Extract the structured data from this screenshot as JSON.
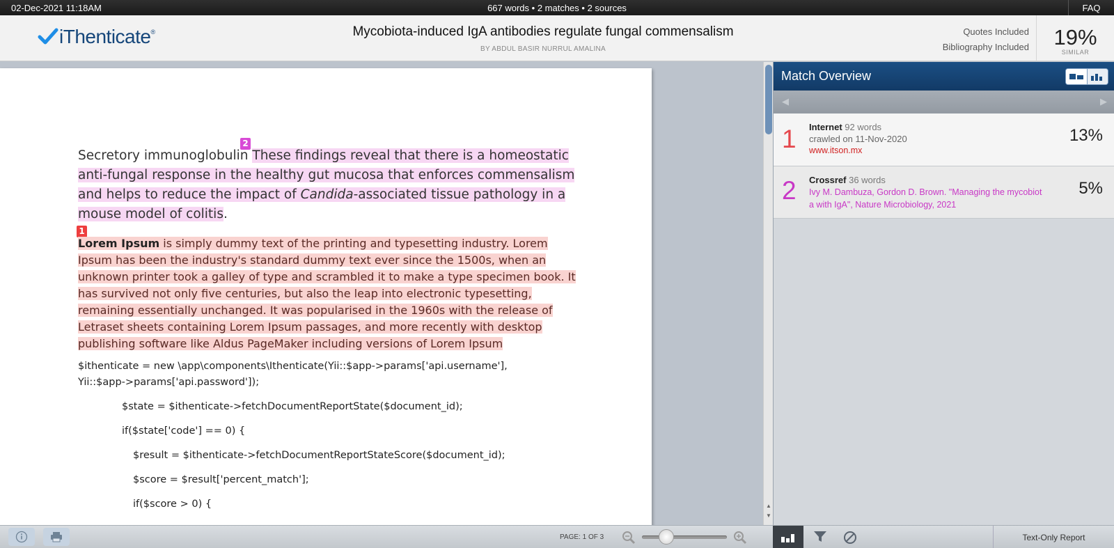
{
  "topbar": {
    "datetime": "02-Dec-2021 11:18AM",
    "summary": "667 words • 2 matches • 2 sources",
    "faq": "FAQ"
  },
  "header": {
    "logo_text": "iThenticate",
    "logo_reg": "®",
    "title": "Mycobiota-induced IgA antibodies regulate fungal commensalism",
    "author": "BY ABDUL BASIR NURRUL AMALINA",
    "quotes": "Quotes Included",
    "bibliography": "Bibliography Included",
    "similarity_pct": "19%",
    "similarity_label": "SIMILAR"
  },
  "document": {
    "para2_plain": "Secretory immunoglobulin ",
    "para2_marker": "2",
    "para2_hl_a": "These findings reveal that there is a homeostatic anti-fungal response in the healthy gut mucosa that enforces commensalism and helps to reduce the impact of ",
    "para2_hl_italic": "Candida",
    "para2_hl_b": "-associated tissue pathology in a mouse model of colitis",
    "para2_end": ".",
    "para1_marker": "1",
    "para1_bold": "Lorem Ipsum",
    "para1_rest": " is simply dummy text of the printing and typesetting industry. Lorem Ipsum has been the industry's standard dummy text ever since the 1500s, when an unknown printer took a galley of type and scrambled it to make a type specimen book. It has survived not only five centuries, but also the leap into electronic typesetting, remaining essentially unchanged. It was popularised in the 1960s with the release of Letraset sheets containing Lorem Ipsum passages, and more recently with desktop publishing software like Aldus PageMaker including versions of Lorem Ipsum",
    "code_lines": [
      "$ithenticate = new \\app\\components\\Ithenticate(Yii::$app->params['api.username'],",
      "Yii::$app->params['api.password']);",
      "$state = $ithenticate->fetchDocumentReportState($document_id);",
      "if($state['code'] == 0) {",
      "$result = $ithenticate->fetchDocumentReportStateScore($document_id);",
      "$score = $result['percent_match'];",
      "if($score > 0) {"
    ]
  },
  "panel": {
    "title": "Match Overview",
    "matches": [
      {
        "number": "1",
        "source": "Internet",
        "words": "92 words",
        "detail": "crawled on 11-Nov-2020",
        "link": "www.itson.mx",
        "percent": "13%",
        "color": "#e5484d"
      },
      {
        "number": "2",
        "source": "Crossref",
        "words": "36 words",
        "link_line1": "Ivy M. Dambuza, Gordon D. Brown. \"Managing the mycobiot",
        "link_line2": "a with IgA\", Nature Microbiology, 2021",
        "percent": "5%",
        "color": "#c838c6"
      }
    ]
  },
  "bottombar": {
    "page_indicator": "PAGE: 1 OF 3",
    "text_only": "Text-Only Report"
  },
  "colors": {
    "accent": "#1b4f84",
    "highlight_match1": "#f9d3d0",
    "highlight_match2": "#f7d7f3"
  },
  "icons": [
    "info-icon",
    "print-icon",
    "zoom-out-icon",
    "zoom-in-icon",
    "bar-chart-icon",
    "filter-icon",
    "exclude-icon",
    "prev-arrow-icon",
    "next-arrow-icon"
  ]
}
